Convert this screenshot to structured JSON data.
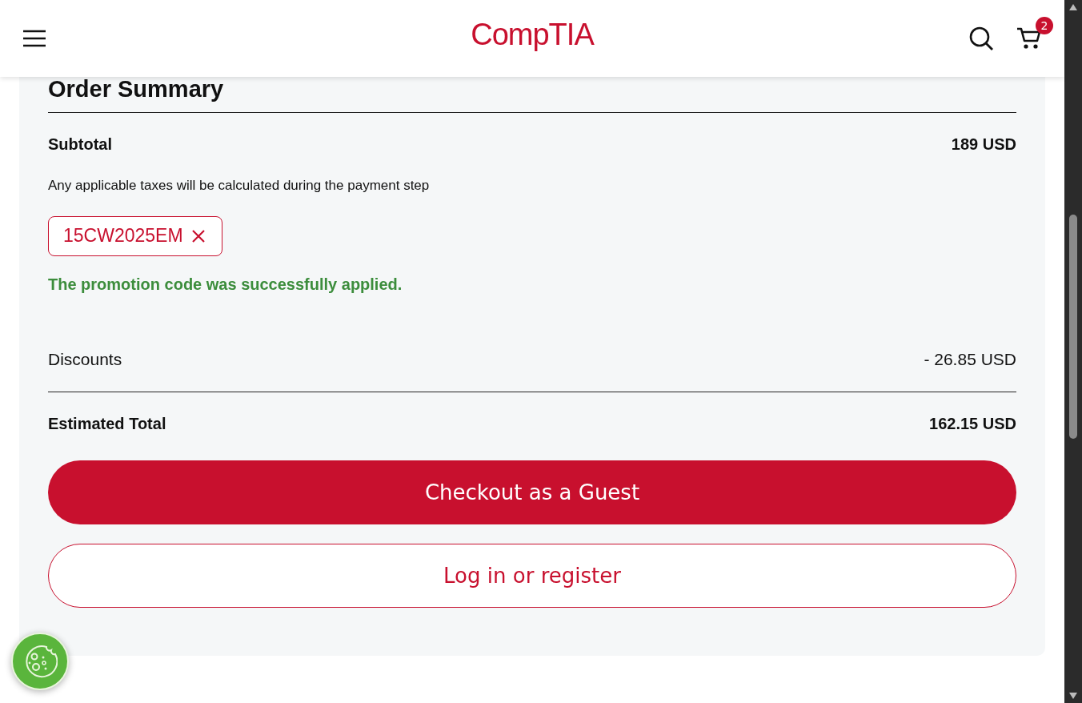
{
  "header": {
    "logo": "CompTIA",
    "cart_count": "2"
  },
  "order_summary": {
    "title": "Order Summary",
    "subtotal": {
      "label": "Subtotal",
      "value": "189 USD"
    },
    "tax_note": "Any applicable taxes will be calculated during the payment step",
    "promo": {
      "code": "15CW2025EM",
      "message": "The promotion code was successfully applied."
    },
    "discounts": {
      "label": "Discounts",
      "value": "- 26.85 USD"
    },
    "total": {
      "label": "Estimated Total",
      "value": "162.15 USD"
    }
  },
  "buttons": [
    {
      "label": "Checkout as a Guest",
      "kind": "primary"
    },
    {
      "label": "Log in or register",
      "kind": "outline"
    }
  ]
}
